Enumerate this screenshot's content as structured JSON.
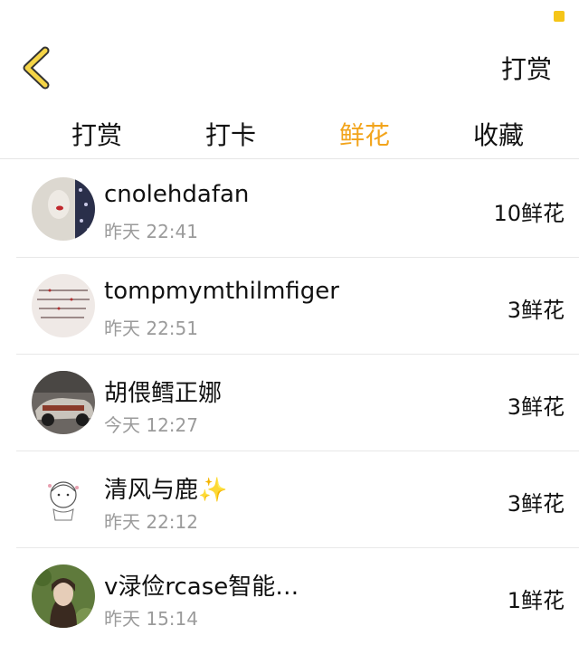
{
  "header": {
    "action_label": "打赏"
  },
  "tabs": [
    {
      "label": "打赏",
      "active": false
    },
    {
      "label": "打卡",
      "active": false
    },
    {
      "label": "鲜花",
      "active": true
    },
    {
      "label": "收藏",
      "active": false
    }
  ],
  "colors": {
    "accent": "#f2a41b",
    "back_icon": "#f5d547"
  },
  "rows": [
    {
      "name": "cnolehdafan",
      "time": "昨天 22:41",
      "amount": "10鲜花"
    },
    {
      "name": "tompmymthilmfiger",
      "time": "昨天 22:51",
      "amount": "3鲜花"
    },
    {
      "name": "胡偎鳕正娜",
      "time": "今天 12:27",
      "amount": "3鲜花"
    },
    {
      "name": "清风与鹿✨",
      "time": "昨天 22:12",
      "amount": "3鲜花"
    },
    {
      "name": "v渌俭rcase智能…",
      "time": "昨天 15:14",
      "amount": "1鲜花"
    }
  ]
}
